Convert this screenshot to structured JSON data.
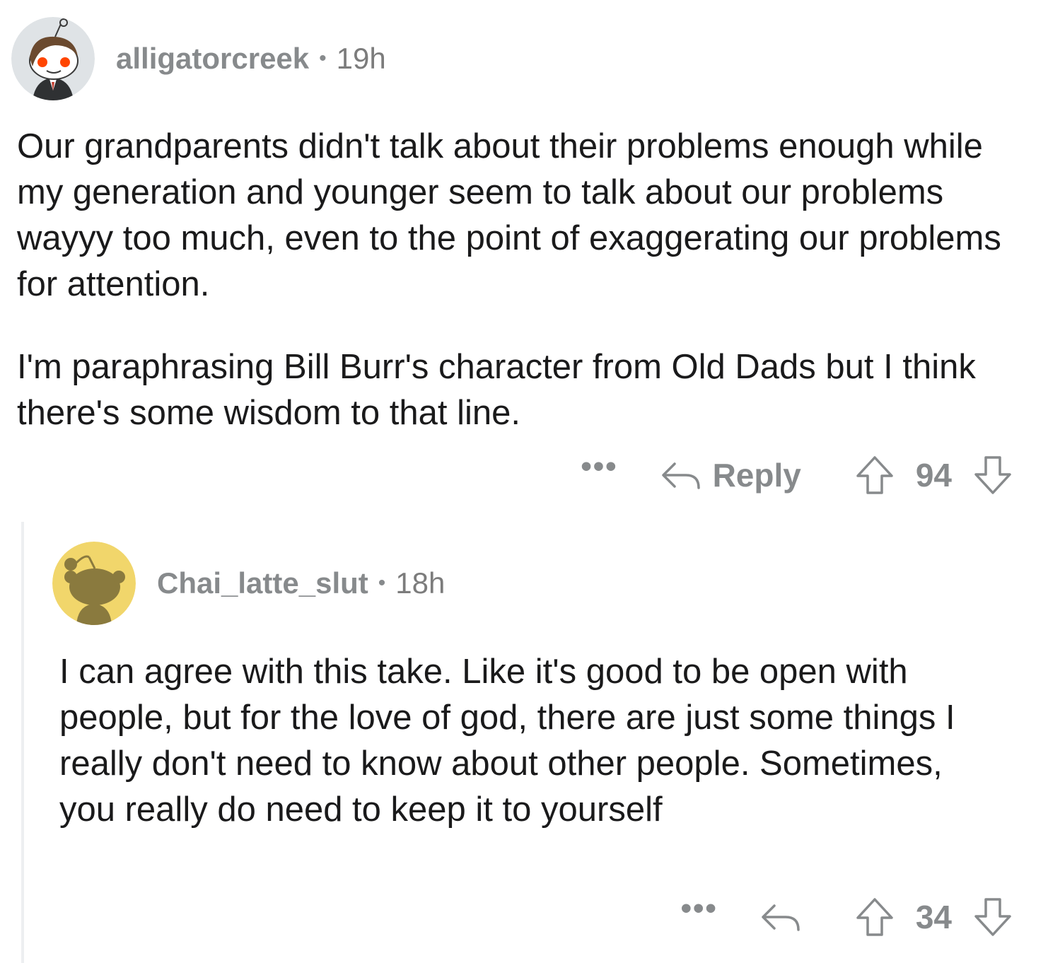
{
  "comments": [
    {
      "username": "alligatorcreek",
      "separator": "•",
      "time": "19h",
      "paragraphs": [
        "Our grandparents didn't talk about their problems enough while my generation and younger seem to talk about our problems wayyy too much, even to the point of exaggerating our problems for attention.",
        "I'm paraphrasing Bill Burr's character from Old Dads but I think there's some wisdom to that line."
      ],
      "more_label": "•••",
      "reply_label": "Reply",
      "score": "94"
    },
    {
      "username": "Chai_latte_slut",
      "separator": "•",
      "time": "18h",
      "paragraphs": [
        "I can agree with this take. Like it's good to be open with people, but for the love of god, there are just some things I really don't need to know about other people. Sometimes, you really do need to keep it to yourself"
      ],
      "more_label": "•••",
      "score": "34"
    }
  ],
  "colors": {
    "meta_text": "#878a8c",
    "body_text": "#1a1a1b",
    "avatar2_bg": "#f1d66b",
    "thread_line": "#edeff1"
  }
}
